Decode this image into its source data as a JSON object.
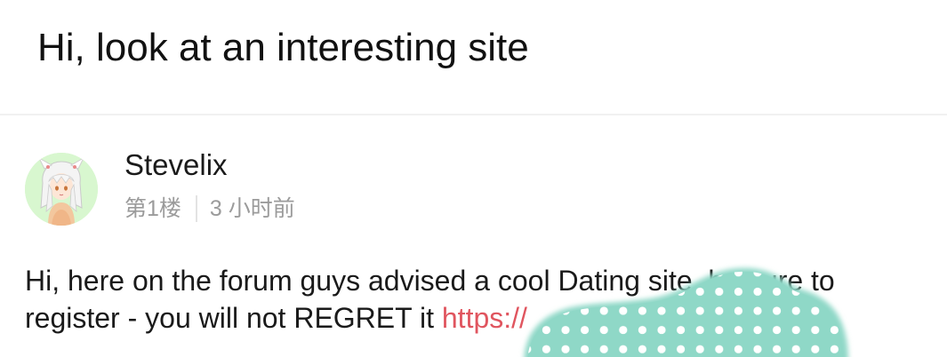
{
  "thread": {
    "title": "Hi, look at an interesting site"
  },
  "post": {
    "username": "Stevelix",
    "floor": "第1楼",
    "time": "3 小时前",
    "body_line1": "Hi, here on the forum guys advised a cool Dating site, be sure to",
    "body_line2_text": "register - you will not REGRET it ",
    "body_link": "https://",
    "avatar_icon": "anime-girl-avatar"
  },
  "colors": {
    "link": "#e0555f",
    "meta": "#9b9b9b",
    "avatar_bg": "#d8f7cf",
    "overlay": "#8fd8c7"
  }
}
